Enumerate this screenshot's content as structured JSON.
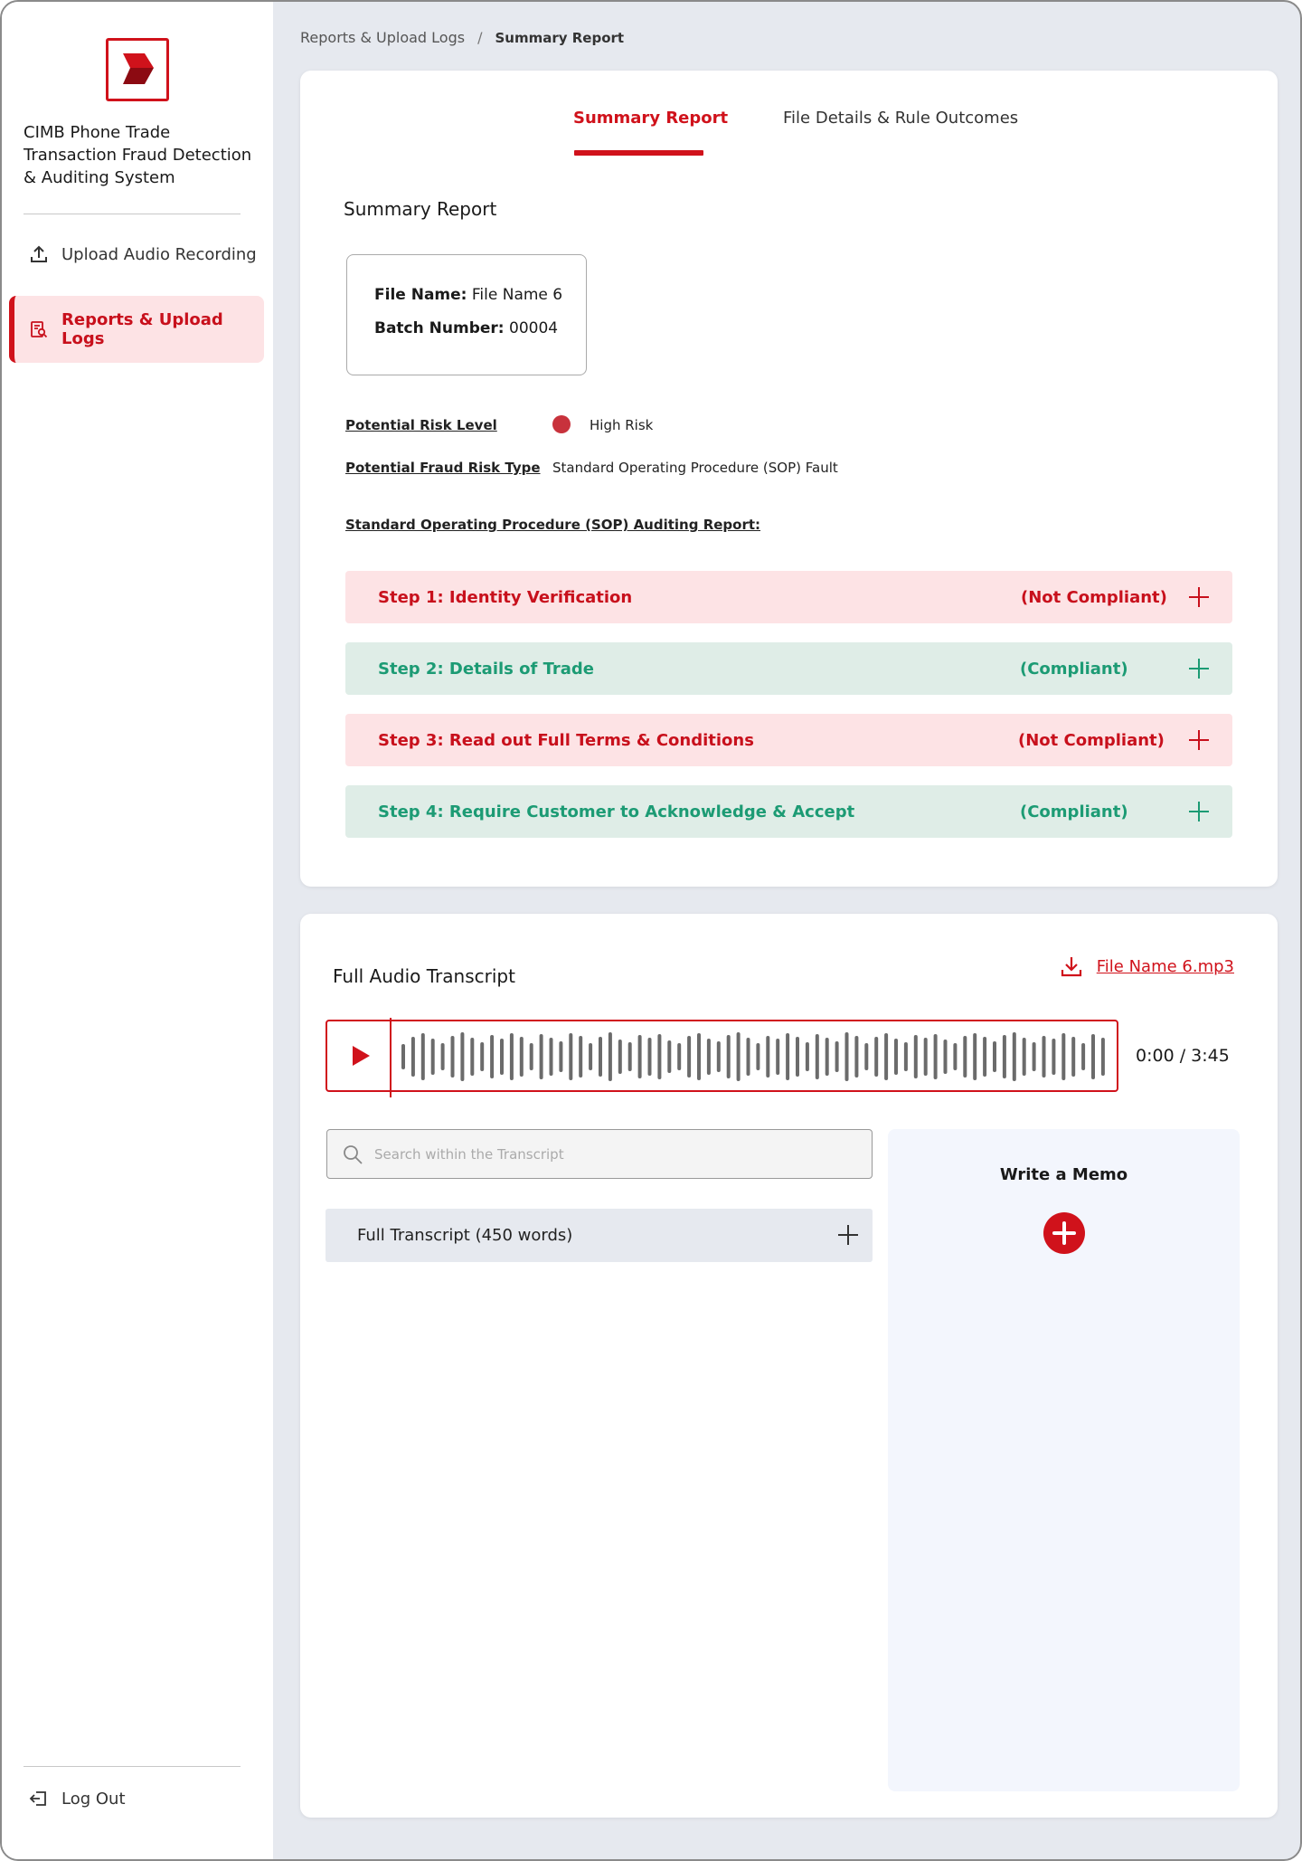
{
  "app": {
    "title": "CIMB Phone Trade Transaction Fraud Detection & Auditing System",
    "brand_color": "#d0121b"
  },
  "sidebar": {
    "items": [
      {
        "label": "Upload Audio Recording",
        "icon": "upload-icon",
        "active": false
      },
      {
        "label": "Reports & Upload Logs",
        "icon": "report-search-icon",
        "active": true
      }
    ],
    "logout_label": "Log Out"
  },
  "breadcrumb": {
    "parent": "Reports & Upload Logs",
    "separator": "/",
    "current": "Summary Report"
  },
  "tabs": [
    {
      "label": "Summary Report",
      "active": true
    },
    {
      "label": "File Details & Rule Outcomes",
      "active": false
    }
  ],
  "summary": {
    "heading": "Summary Report",
    "file_name_label": "File Name:",
    "file_name": "File Name 6",
    "batch_label": "Batch Number:",
    "batch_number": "00004",
    "risk_level_label": "Potential Risk Level",
    "risk_level": "High Risk",
    "risk_color": "#c8323c",
    "fraud_type_label": "Potential Fraud Risk Type",
    "fraud_type": "Standard Operating Procedure (SOP) Fault",
    "sop_heading": "Standard Operating Procedure (SOP) Auditing Report:",
    "steps": [
      {
        "title": "Step 1: Identity Verification",
        "status": "(Not Compliant)"
      },
      {
        "title": "Step 2: Details of Trade",
        "status": "(Compliant)"
      },
      {
        "title": "Step 3: Read out Full Terms & Conditions",
        "status": "(Not Compliant)"
      },
      {
        "title": "Step 4: Require Customer to Acknowledge & Accept",
        "status": "(Compliant)"
      }
    ]
  },
  "transcript": {
    "heading": "Full Audio Transcript",
    "download_label": "File Name 6.mp3",
    "time": "0:00 / 3:45",
    "search_placeholder": "Search within the Transcript",
    "full_transcript_label": "Full Transcript (450 words)",
    "memo_title": "Write a Memo"
  }
}
